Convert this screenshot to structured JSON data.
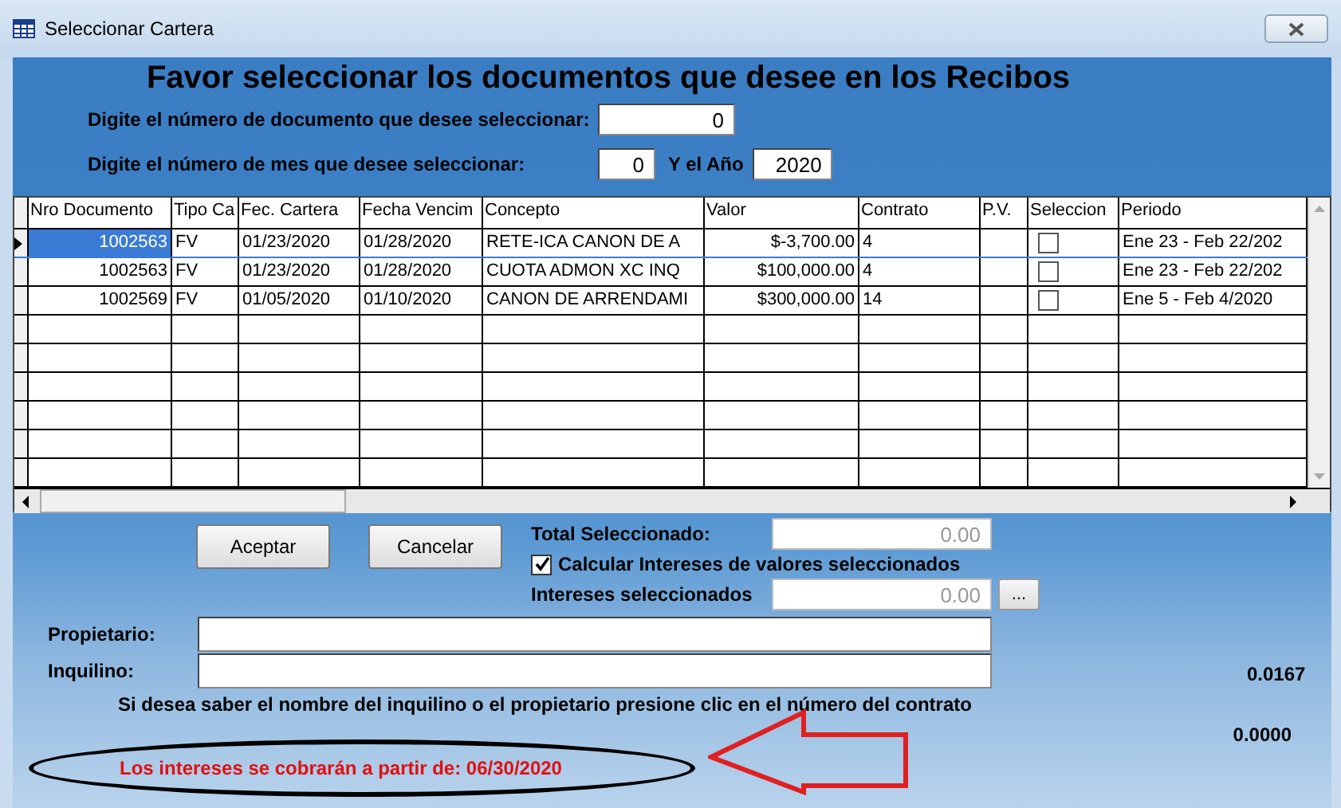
{
  "window": {
    "title": "Seleccionar Cartera"
  },
  "heading": "Favor seleccionar los documentos que desee en los Recibos",
  "doc_filter": {
    "label": "Digite el número de documento que desee seleccionar:",
    "value": "0"
  },
  "month_filter": {
    "label": "Digite el número de mes que desee seleccionar:",
    "value": "0",
    "year_label": "Y el Año",
    "year_value": "2020"
  },
  "table": {
    "columns": [
      "Nro Documento",
      "Tipo Ca",
      "Fec. Cartera",
      "Fecha Vencim",
      "Concepto",
      "Valor",
      "Contrato",
      "P.V.",
      "Seleccion",
      "Periodo"
    ],
    "rows": [
      {
        "selected": true,
        "nro": "1002563",
        "tipo": "FV",
        "fec_cartera": "01/23/2020",
        "fecha_venc": "01/28/2020",
        "concepto": "RETE-ICA CANON DE A",
        "valor": "$-3,700.00",
        "contrato": "4",
        "checked": false,
        "periodo": "Ene 23 - Feb 22/202"
      },
      {
        "selected": false,
        "nro": "1002563",
        "tipo": "FV",
        "fec_cartera": "01/23/2020",
        "fecha_venc": "01/28/2020",
        "concepto": "CUOTA ADMON XC INQ",
        "valor": "$100,000.00",
        "contrato": "4",
        "checked": false,
        "periodo": "Ene 23 - Feb 22/202"
      },
      {
        "selected": false,
        "nro": "1002569",
        "tipo": "FV",
        "fec_cartera": "01/05/2020",
        "fecha_venc": "01/10/2020",
        "concepto": "CANON DE ARRENDAMI",
        "valor": "$300,000.00",
        "contrato": "14",
        "checked": false,
        "periodo": "Ene 5 - Feb 4/2020"
      }
    ]
  },
  "buttons": [
    "Aceptar",
    "Cancelar"
  ],
  "total": {
    "label": "Total Seleccionado:",
    "value": "0.00",
    "disabled": true
  },
  "calc_interest": {
    "label": "Calcular Intereses de valores seleccionados",
    "checked": true
  },
  "interest": {
    "label": "Intereses seleccionados",
    "value": "0.00",
    "disabled": true,
    "button": "..."
  },
  "owner": {
    "label": "Propietario:"
  },
  "tenant": {
    "label": "Inquilino:"
  },
  "hint": "Si desea saber el nombre del inquilino o el propietario presione clic en el número del contrato",
  "rate_1": "0.0167",
  "rate_2": "0.0000",
  "notice": "Los intereses se cobrarán a partir de: 06/30/2020"
}
